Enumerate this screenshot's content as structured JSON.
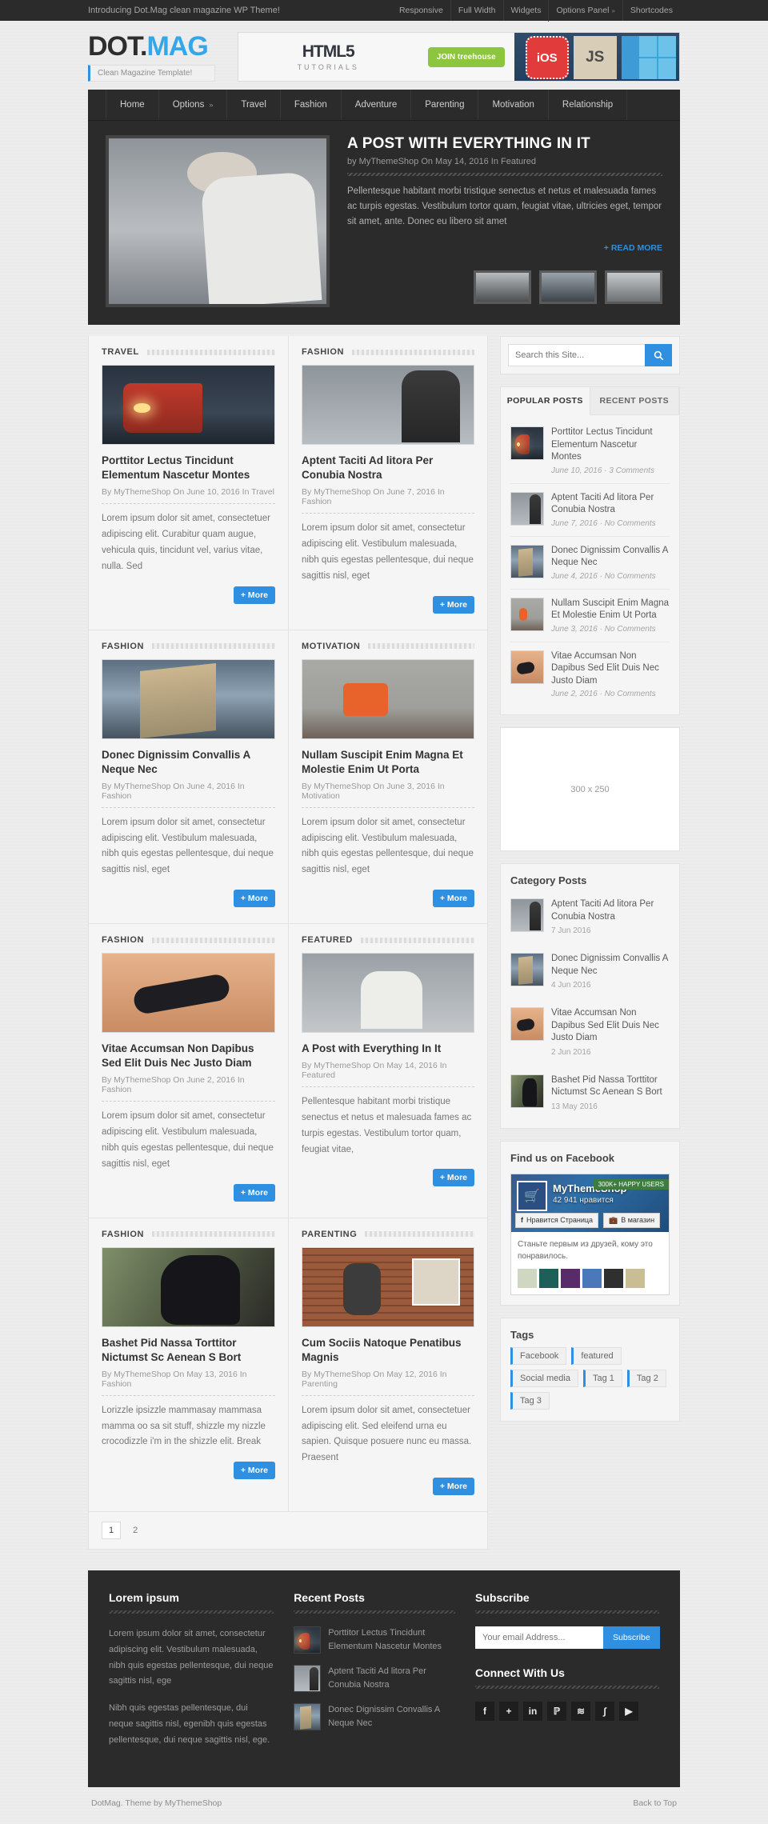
{
  "topbar": {
    "intro": "Introducing Dot.Mag clean magazine WP Theme!",
    "links": [
      {
        "label": "Responsive",
        "caret": ""
      },
      {
        "label": "Full Width",
        "caret": ""
      },
      {
        "label": "Widgets",
        "caret": ""
      },
      {
        "label": "Options Panel",
        "caret": "»"
      },
      {
        "label": "Shortcodes",
        "caret": ""
      }
    ]
  },
  "header": {
    "logo_dot": "DOT.",
    "logo_mag": "MAG",
    "tagline": "Clean Magazine Template!",
    "banner": {
      "html5": "HTML5",
      "tutorials": "TUTORIALS",
      "cta": "JOIN treehouse",
      "ios": "iOS",
      "js": "JS"
    }
  },
  "nav": [
    {
      "label": "Home",
      "caret": ""
    },
    {
      "label": "Options",
      "caret": "»"
    },
    {
      "label": "Travel",
      "caret": ""
    },
    {
      "label": "Fashion",
      "caret": ""
    },
    {
      "label": "Adventure",
      "caret": ""
    },
    {
      "label": "Parenting",
      "caret": ""
    },
    {
      "label": "Motivation",
      "caret": ""
    },
    {
      "label": "Relationship",
      "caret": ""
    }
  ],
  "slider": {
    "title": "A POST WITH EVERYTHING IN IT",
    "meta": "by MyThemeShop On May 14, 2016 In Featured",
    "excerpt": "Pellentesque habitant morbi tristique senectus et netus et malesuada fames ac turpis egestas. Vestibulum tortor quam, feugiat vitae, ultricies eget, tempor sit amet, ante. Donec eu libero sit amet",
    "read_more": "+ READ MORE"
  },
  "posts": [
    {
      "category": "TRAVEL",
      "title": "Porttitor Lectus Tincidunt Elementum Nascetur Montes",
      "meta": "By MyThemeShop On June 10, 2016 In Travel",
      "excerpt": "Lorem ipsum dolor sit amet, consectetuer adipiscing elit. Curabitur quam augue, vehicula quis, tincidunt vel, varius vitae, nulla. Sed",
      "more": "+ More",
      "img": "im-train"
    },
    {
      "category": "FASHION",
      "title": "Aptent Taciti Ad litora Per Conubia Nostra",
      "meta": "By MyThemeShop On June 7, 2016 In Fashion",
      "excerpt": "Lorem ipsum dolor sit amet, consectetur adipiscing elit. Vestibulum malesuada, nibh quis egestas pellentesque, dui neque sagittis nisl, eget",
      "more": "+ More",
      "img": "im-fashion"
    },
    {
      "category": "FASHION",
      "title": "Donec Dignissim Convallis A Neque Nec",
      "meta": "By MyThemeShop On June 4, 2016 In Fashion",
      "excerpt": "Lorem ipsum dolor sit amet, consectetur adipiscing elit. Vestibulum malesuada, nibh quis egestas pellentesque, dui neque sagittis nisl, eget",
      "more": "+ More",
      "img": "im-mural"
    },
    {
      "category": "MOTIVATION",
      "title": "Nullam Suscipit Enim Magna Et Molestie Enim Ut Porta",
      "meta": "By MyThemeShop On June 3, 2016 In Motivation",
      "excerpt": "Lorem ipsum dolor sit amet, consectetur adipiscing elit. Vestibulum malesuada, nibh quis egestas pellentesque, dui neque sagittis nisl, eget",
      "more": "+ More",
      "img": "im-can"
    },
    {
      "category": "FASHION",
      "title": "Vitae Accumsan Non Dapibus Sed Elit Duis Nec Justo Diam",
      "meta": "By MyThemeShop On June 2, 2016 In Fashion",
      "excerpt": "Lorem ipsum dolor sit amet, consectetur adipiscing elit. Vestibulum malesuada, nibh quis egestas pellentesque, dui neque sagittis nisl, eget",
      "more": "+ More",
      "img": "im-woman"
    },
    {
      "category": "FEATURED",
      "title": "A Post with Everything In It",
      "meta": "By MyThemeShop On May 14, 2016 In Featured",
      "excerpt": "Pellentesque habitant morbi tristique senectus et netus et malesuada fames ac turpis egestas. Vestibulum tortor quam, feugiat vitae,",
      "more": "+ More",
      "img": "im-kid2"
    },
    {
      "category": "FASHION",
      "title": "Bashet Pid Nassa Torttitor Nictumst Sc Aenean S Bort",
      "meta": "By MyThemeShop On May 13, 2016 In Fashion",
      "excerpt": "Lorizzle ipsizzle mammasay mammasa mamma oo sa sit stuff, shizzle my nizzle crocodizzle i'm in the shizzle elit. Break",
      "more": "+ More",
      "img": "im-black"
    },
    {
      "category": "PARENTING",
      "title": "Cum Sociis Natoque Penatibus Magnis",
      "meta": "By MyThemeShop On May 12, 2016 In Parenting",
      "excerpt": "Lorem ipsum dolor sit amet, consectetuer adipiscing elit. Sed eleifend urna eu sapien. Quisque posuere nunc eu massa. Praesent",
      "more": "+ More",
      "img": "im-brick"
    }
  ],
  "pagination": [
    "1",
    "2"
  ],
  "sidebar": {
    "search": {
      "placeholder": "Search this Site...",
      "icon": "search-icon"
    },
    "tabs": [
      {
        "label": "POPULAR POSTS",
        "active": true
      },
      {
        "label": "RECENT POSTS",
        "active": false
      }
    ],
    "popular_posts": [
      {
        "title": "Porttitor Lectus Tincidunt Elementum Nascetur Montes",
        "meta": "June 10, 2016 · 3 Comments",
        "img": "im-train"
      },
      {
        "title": "Aptent Taciti Ad litora Per Conubia Nostra",
        "meta": "June 7, 2016 · No Comments",
        "img": "im-fashion"
      },
      {
        "title": "Donec Dignissim Convallis A Neque Nec",
        "meta": "June 4, 2016 · No Comments",
        "img": "im-mural"
      },
      {
        "title": "Nullam Suscipit Enim Magna Et Molestie Enim Ut Porta",
        "meta": "June 3, 2016 · No Comments",
        "img": "im-can"
      },
      {
        "title": "Vitae Accumsan Non Dapibus Sed Elit Duis Nec Justo Diam",
        "meta": "June 2, 2016 · No Comments",
        "img": "im-woman"
      }
    ],
    "ad": "300 x 250",
    "category_posts_title": "Category Posts",
    "category_posts": [
      {
        "title": "Aptent Taciti Ad litora Per Conubia Nostra",
        "date": "7 Jun 2016",
        "img": "im-fashion"
      },
      {
        "title": "Donec Dignissim Convallis A Neque Nec",
        "date": "4 Jun 2016",
        "img": "im-mural"
      },
      {
        "title": "Vitae Accumsan Non Dapibus Sed Elit Duis Nec Justo Diam",
        "date": "2 Jun 2016",
        "img": "im-woman"
      },
      {
        "title": "Bashet Pid Nassa Torttitor Nictumst Sc Aenean S Bort",
        "date": "13 May 2016",
        "img": "im-black"
      }
    ],
    "facebook": {
      "title": "Find us on Facebook",
      "page_name": "MyThemeShop",
      "likes": "42 941 нравится",
      "ribbon": "300K+ HAPPY USERS",
      "like_button": "Нравится Страница",
      "shop_button": "В магазин",
      "note": "Станьте первым из друзей, кому это понравилось."
    },
    "tags_title": "Tags",
    "tags": [
      "Facebook",
      "featured",
      "Social media",
      "Tag 1",
      "Tag 2",
      "Tag 3"
    ]
  },
  "footer": {
    "col1": {
      "title": "Lorem ipsum",
      "p1": "Lorem ipsum dolor sit amet, consectetur adipiscing elit. Vestibulum malesuada, nibh quis egestas pellentesque, dui neque sagittis nisl, ege",
      "p2": "Nibh quis egestas pellentesque, dui neque sagittis nisl, egenibh quis egestas pellentesque, dui neque sagittis nisl, ege."
    },
    "col2": {
      "title": "Recent Posts",
      "items": [
        {
          "title": "Porttitor Lectus Tincidunt Elementum Nascetur Montes",
          "img": "im-train"
        },
        {
          "title": "Aptent Taciti Ad litora Per Conubia Nostra",
          "img": "im-fashion"
        },
        {
          "title": "Donec Dignissim Convallis A Neque Nec",
          "img": "im-mural"
        }
      ]
    },
    "col3": {
      "subscribe_title": "Subscribe",
      "email_placeholder": "Your email Address...",
      "subscribe_button": "Subscribe",
      "connect_title": "Connect With Us",
      "socials": [
        {
          "name": "facebook-icon",
          "glyph": "f"
        },
        {
          "name": "google-plus-icon",
          "glyph": "+"
        },
        {
          "name": "linkedin-icon",
          "glyph": "in"
        },
        {
          "name": "pinterest-icon",
          "glyph": "ℙ"
        },
        {
          "name": "rss-icon",
          "glyph": "≋"
        },
        {
          "name": "stumbleupon-icon",
          "glyph": "∫"
        },
        {
          "name": "youtube-icon",
          "glyph": "▶"
        }
      ]
    }
  },
  "copyright": {
    "left": "DotMag. Theme by MyThemeShop",
    "right": "Back to Top"
  }
}
